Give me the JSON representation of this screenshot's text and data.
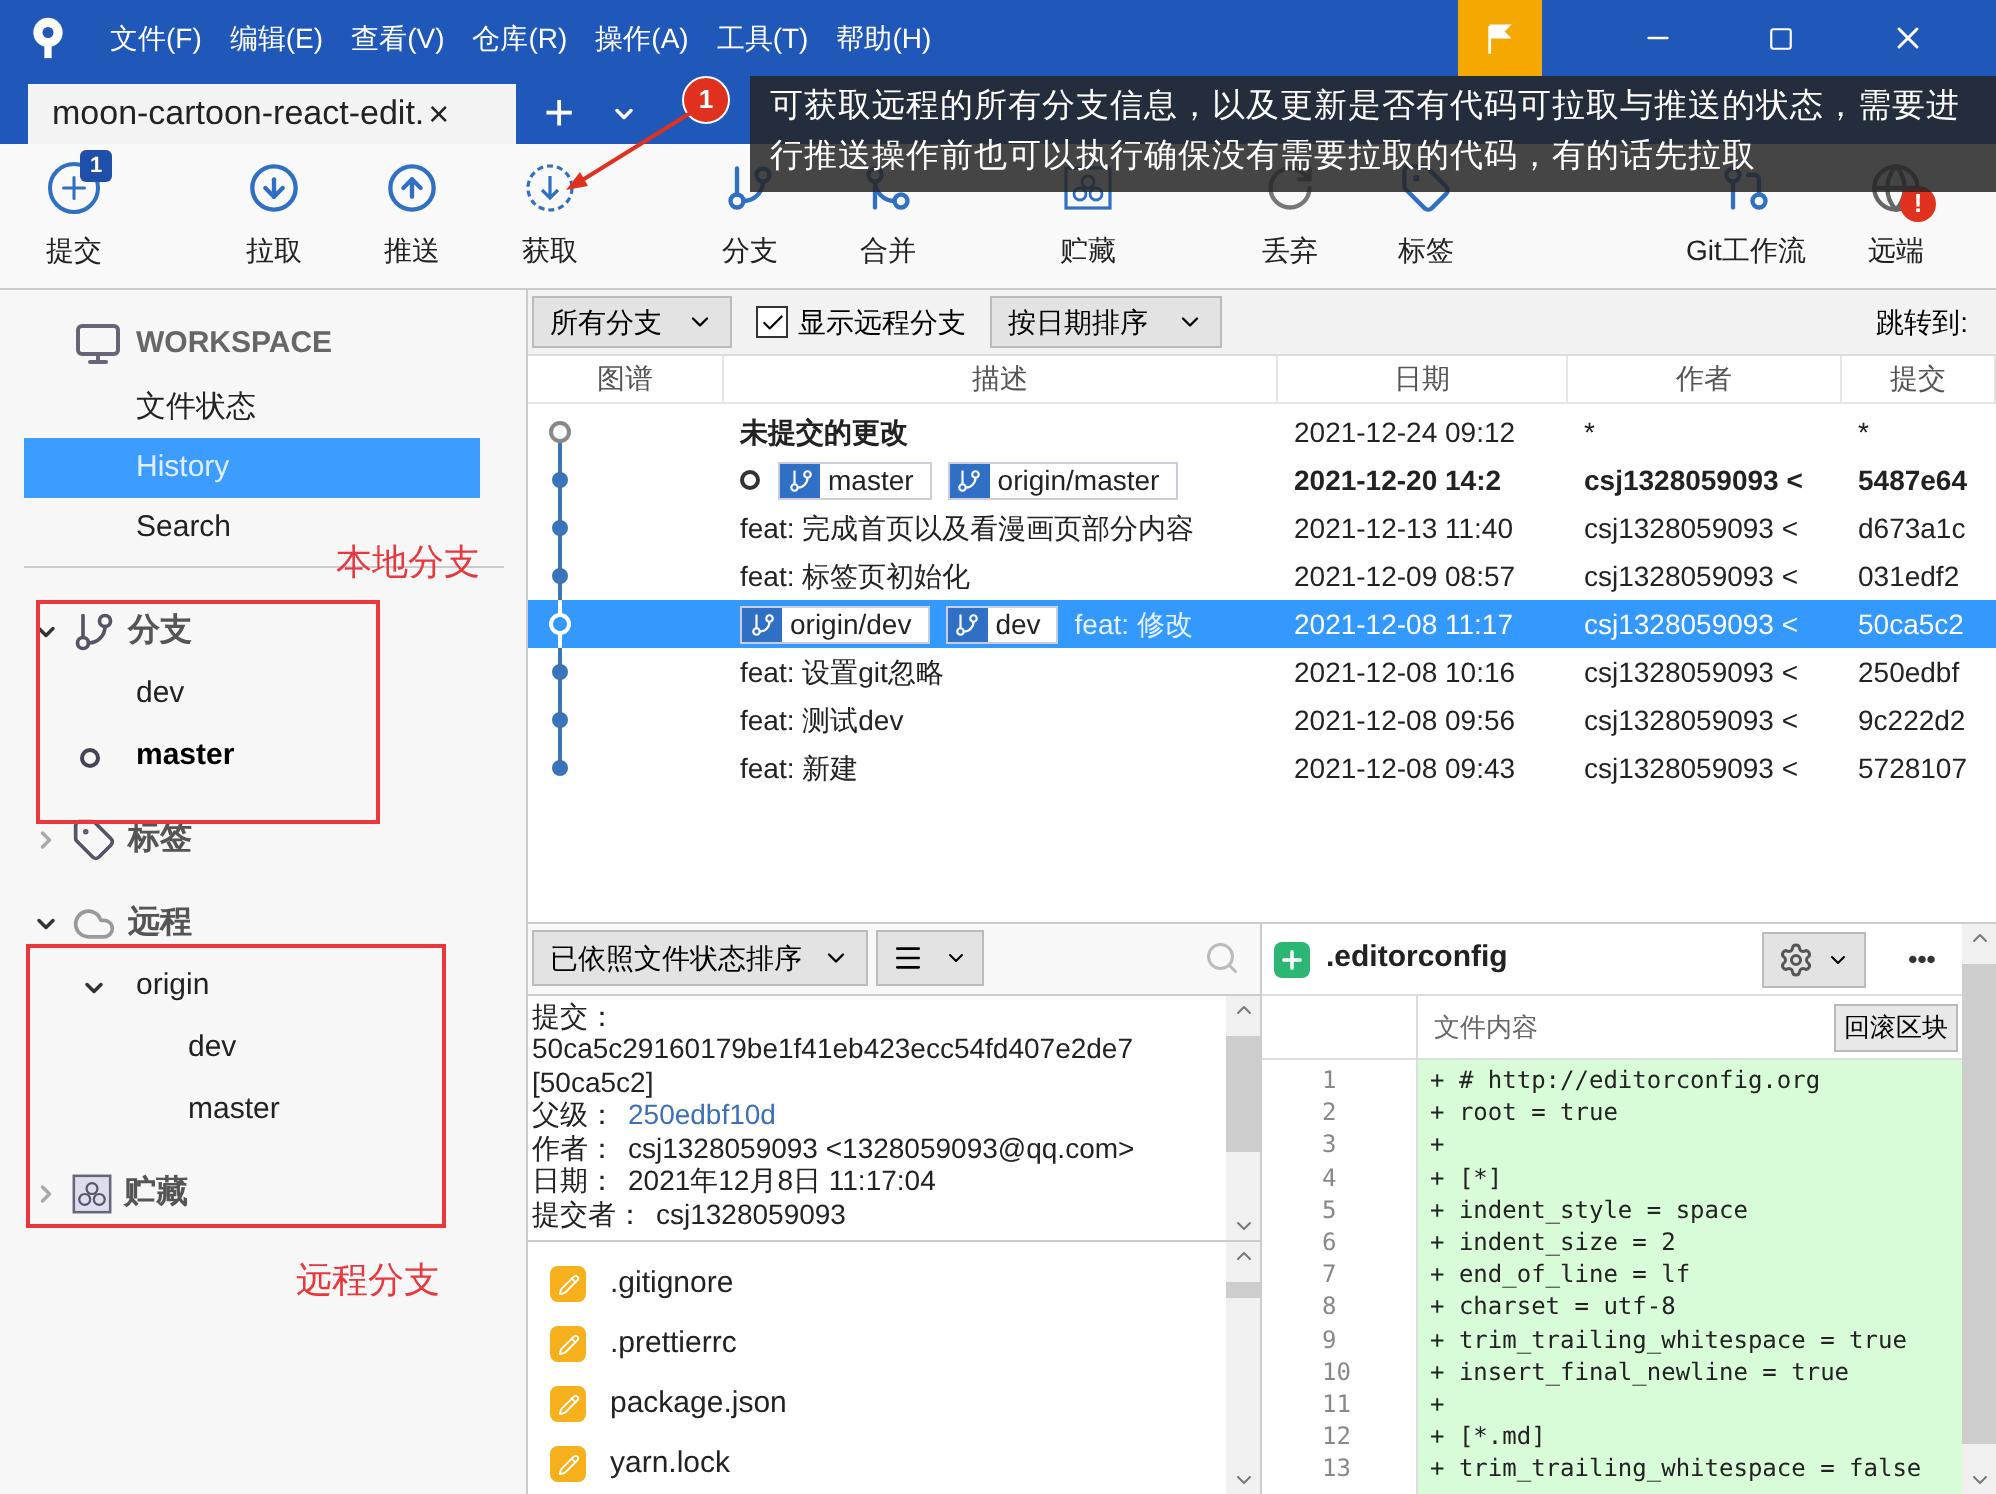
{
  "menu": [
    "文件(F)",
    "编辑(E)",
    "查看(V)",
    "仓库(R)",
    "操作(A)",
    "工具(T)",
    "帮助(H)"
  ],
  "tab": {
    "title": "moon-cartoon-react-edit.",
    "close": "×"
  },
  "new_tab": "+",
  "callout": {
    "number": "1",
    "text": "可获取远程的所有分支信息，以及更新是否有代码可拉取与推送的状态，需要进行推送操作前也可以执行确保没有需要拉取的代码，有的话先拉取"
  },
  "toolbar": [
    {
      "kind": "commit",
      "label": "提交",
      "badge": "1"
    },
    {
      "kind": "pull",
      "label": "拉取"
    },
    {
      "kind": "push",
      "label": "推送"
    },
    {
      "kind": "fetch",
      "label": "获取"
    },
    {
      "kind": "branch",
      "label": "分支"
    },
    {
      "kind": "merge",
      "label": "合并"
    },
    {
      "kind": "stash",
      "label": "贮藏"
    },
    {
      "kind": "discard",
      "label": "丢弃"
    },
    {
      "kind": "tag",
      "label": "标签"
    },
    {
      "kind": "flow",
      "label": "Git工作流"
    },
    {
      "kind": "remote",
      "label": "远端",
      "alert": "!"
    }
  ],
  "workspace": {
    "title": "WORKSPACE",
    "items": [
      {
        "label": "文件状态",
        "selected": false
      },
      {
        "label": "History",
        "selected": true
      },
      {
        "label": "Search",
        "selected": false
      }
    ]
  },
  "sections": [
    {
      "kind": "branches",
      "label": "分支",
      "expanded": true,
      "children": [
        {
          "label": "dev",
          "current": false
        },
        {
          "label": "master",
          "current": true
        }
      ]
    },
    {
      "kind": "tags",
      "label": "标签",
      "expanded": false
    },
    {
      "kind": "remotes",
      "label": "远程",
      "expanded": true,
      "children": [
        {
          "label": "origin",
          "expanded": true,
          "children": [
            {
              "label": "dev"
            },
            {
              "label": "master"
            }
          ]
        }
      ]
    },
    {
      "kind": "stashes",
      "label": "贮藏",
      "expanded": false
    }
  ],
  "annotations": {
    "local": "本地分支",
    "remote": "远程分支"
  },
  "filters": {
    "branches": "所有分支",
    "show_remote": {
      "label": "显示远程分支",
      "checked": true
    },
    "sort": "按日期排序",
    "jump": "跳转到:"
  },
  "columns": [
    "图谱",
    "描述",
    "日期",
    "作者",
    "提交"
  ],
  "commits": [
    {
      "uncommitted": true,
      "selected": false,
      "head": false,
      "description": "未提交的更改",
      "date": "2021-12-24 09:12",
      "author": "*",
      "hash": "*"
    },
    {
      "uncommitted": false,
      "selected": false,
      "head": true,
      "refs": [
        "master",
        "origin/master"
      ],
      "date": "2021-12-20 14:2",
      "author": "csj1328059093 <",
      "hash": "5487e64"
    },
    {
      "uncommitted": false,
      "selected": false,
      "head": false,
      "description": "feat: 完成首页以及看漫画页部分内容",
      "date": "2021-12-13 11:40",
      "author": "csj1328059093 <",
      "hash": "d673a1c"
    },
    {
      "uncommitted": false,
      "selected": false,
      "head": false,
      "description": "feat: 标签页初始化",
      "date": "2021-12-09 08:57",
      "author": "csj1328059093 <",
      "hash": "031edf2"
    },
    {
      "uncommitted": false,
      "selected": true,
      "head": false,
      "refs": [
        "origin/dev",
        "dev"
      ],
      "description": "feat: 修改",
      "date": "2021-12-08 11:17",
      "author": "csj1328059093 <",
      "hash": "50ca5c2"
    },
    {
      "uncommitted": false,
      "selected": false,
      "head": false,
      "description": "feat: 设置git忽略",
      "date": "2021-12-08 10:16",
      "author": "csj1328059093 <",
      "hash": "250edbf"
    },
    {
      "uncommitted": false,
      "selected": false,
      "head": false,
      "description": "feat: 测试dev",
      "date": "2021-12-08 09:56",
      "author": "csj1328059093 <",
      "hash": "9c222d2"
    },
    {
      "uncommitted": false,
      "selected": false,
      "head": false,
      "description": "feat: 新建",
      "date": "2021-12-08 09:43",
      "author": "csj1328059093 <",
      "hash": "5728107"
    }
  ],
  "files_toolbar": {
    "sort": "已依照文件状态排序"
  },
  "details": {
    "commit_label": "提交：",
    "hash": "50ca5c29160179be1f41eb423ecc54fd407e2de7",
    "short_hash": "[50ca5c2]",
    "fields": [
      {
        "label": "父级：",
        "value": "250edbf10d",
        "kind": "link"
      },
      {
        "label": "作者：",
        "value": "csj1328059093 <1328059093@qq.com>",
        "kind": "text"
      },
      {
        "label": "日期：",
        "value": "2021年12月8日 11:17:04",
        "kind": "text"
      },
      {
        "label": "提交者：",
        "value": "csj1328059093",
        "kind": "text"
      }
    ]
  },
  "files": [
    {
      "name": ".gitignore",
      "kind": "modified"
    },
    {
      "name": ".prettierrc",
      "kind": "modified"
    },
    {
      "name": "package.json",
      "kind": "modified"
    },
    {
      "name": "yarn.lock",
      "kind": "modified"
    }
  ],
  "diff": {
    "file": ".editorconfig",
    "kind": "added",
    "more": "•••",
    "header": "文件内容",
    "revert": "回滚区块",
    "lines": [
      {
        "number": "1",
        "text": "+ # http://editorconfig.org"
      },
      {
        "number": "2",
        "text": "+ root = true"
      },
      {
        "number": "3",
        "text": "+"
      },
      {
        "number": "4",
        "text": "+ [*]"
      },
      {
        "number": "5",
        "text": "+ indent_style = space"
      },
      {
        "number": "6",
        "text": "+ indent_size = 2"
      },
      {
        "number": "7",
        "text": "+ end_of_line = lf"
      },
      {
        "number": "8",
        "text": "+ charset = utf-8"
      },
      {
        "number": "9",
        "text": "+ trim_trailing_whitespace = true"
      },
      {
        "number": "10",
        "text": "+ insert_final_newline = true"
      },
      {
        "number": "11",
        "text": "+"
      },
      {
        "number": "12",
        "text": "+ [*.md]"
      },
      {
        "number": "13",
        "text": "+ trim_trailing_whitespace = false"
      }
    ]
  }
}
